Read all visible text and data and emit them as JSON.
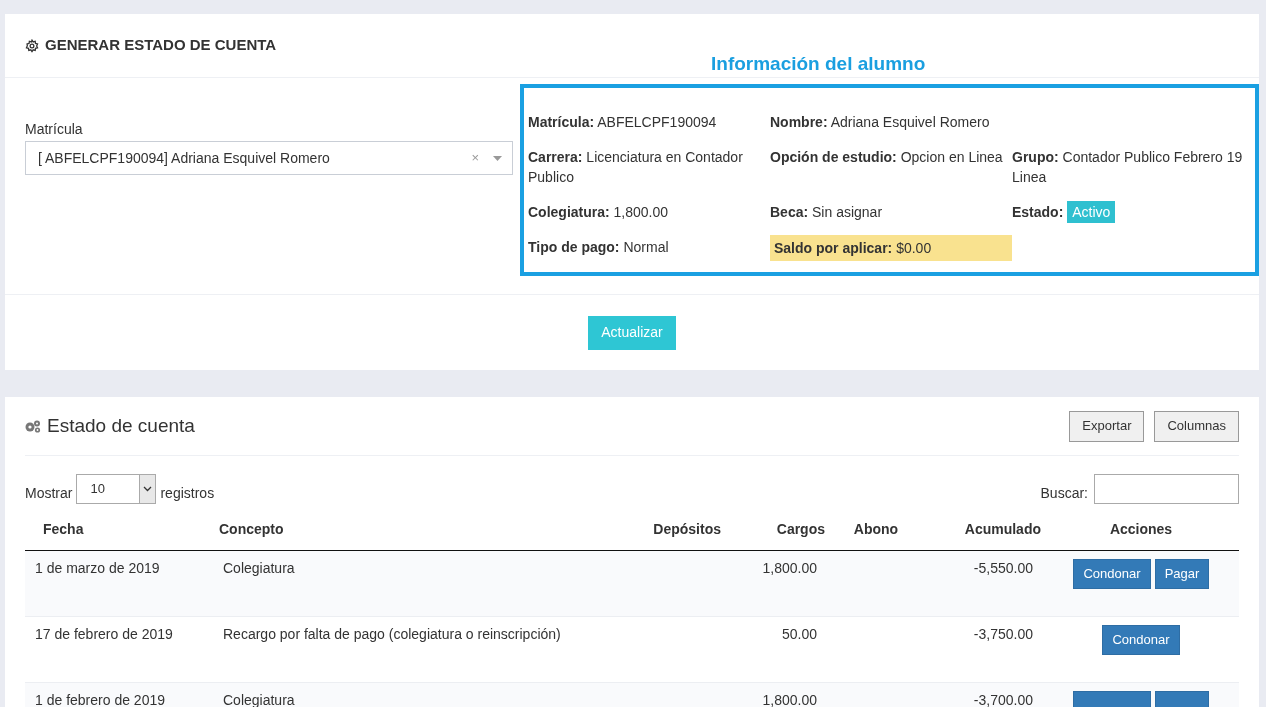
{
  "generator": {
    "title": "GENERAR ESTADO DE CUENTA",
    "info_heading": "Información del alumno",
    "field_label": "Matrícula",
    "select_value": "[ ABFELCPF190094] Adriana Esquivel Romero",
    "clear_glyph": "×",
    "info": [
      {
        "label": "Matrícula:",
        "value": "ABFELCPF190094"
      },
      {
        "label": "Nombre:",
        "value": "Adriana Esquivel Romero"
      },
      {
        "kind": "empty"
      },
      {
        "label": "Carrera:",
        "value": "Licenciatura en Contador Publico"
      },
      {
        "label": "Opción de estudio:",
        "value": "Opcion en Linea"
      },
      {
        "label": "Grupo:",
        "value": "Contador Publico Febrero 19 Linea"
      },
      {
        "label": "Colegiatura:",
        "value": "1,800.00"
      },
      {
        "label": "Beca:",
        "value": "Sin asignar"
      },
      {
        "label": "Estado:",
        "value": "Activo",
        "kind": "badge"
      },
      {
        "label": "Tipo de pago:",
        "value": "Normal"
      },
      {
        "label": "Saldo por aplicar:",
        "value": "$0.00",
        "kind": "highlight"
      }
    ],
    "button": "Actualizar"
  },
  "statement": {
    "title": "Estado de cuenta",
    "buttons": [
      "Exportar",
      "Columnas"
    ],
    "show_label": "Mostrar",
    "show_value": "10",
    "show_suffix": "registros",
    "search_label": "Buscar:",
    "table": {
      "columns": [
        "Fecha",
        "Concepto",
        "Depósitos",
        "Cargos",
        "Abono",
        "Acumulado",
        "Acciones"
      ],
      "rows": [
        {
          "fecha": "1 de marzo de 2019",
          "concepto": "Colegiatura",
          "cargos": "1,800.00",
          "acumulado": "-5,550.00",
          "actions": [
            {
              "kind": "condonar",
              "label": "Condonar"
            },
            {
              "kind": "pagar",
              "label": "Pagar"
            }
          ]
        },
        {
          "fecha": "17 de febrero de 2019",
          "concepto": "Recargo por falta de pago (colegiatura o reinscripción)",
          "cargos": "50.00",
          "acumulado": "-3,750.00",
          "actions": [
            {
              "kind": "condonar",
              "label": "Condonar"
            }
          ]
        },
        {
          "fecha": "1 de febrero de 2019",
          "concepto": "Colegiatura",
          "cargos": "1,800.00",
          "acumulado": "-3,700.00",
          "actions": [
            {
              "kind": "condonar"
            },
            {
              "kind": "pagar"
            }
          ]
        }
      ]
    }
  }
}
